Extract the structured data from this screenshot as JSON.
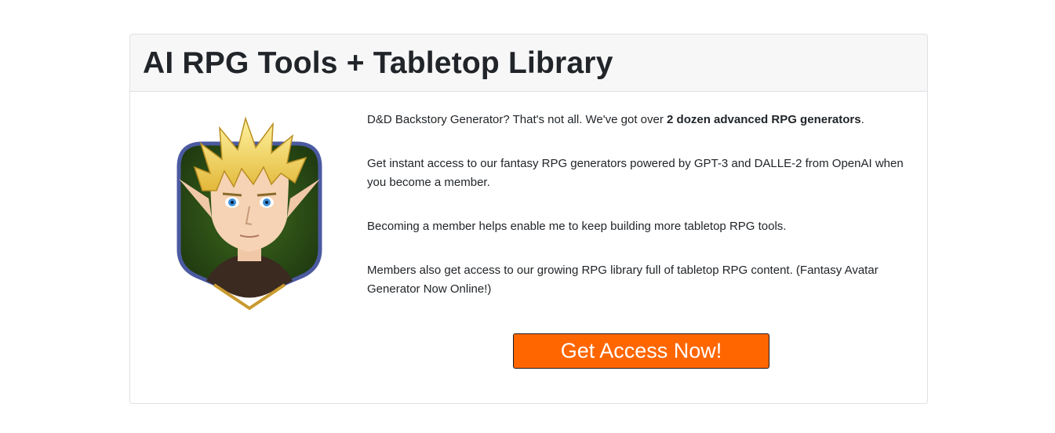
{
  "header": {
    "title": "AI RPG Tools + Tabletop Library"
  },
  "content": {
    "p1_before": "D&D Backstory Generator? That's not all. We've got over ",
    "p1_bold": "2 dozen advanced RPG generators",
    "p1_after": ".",
    "p2": "Get instant access to our fantasy RPG generators powered by GPT-3 and DALLE-2 from OpenAI when you become a member.",
    "p3": "Becoming a member helps enable me to keep building more tabletop RPG tools.",
    "p4": "Members also get access to our growing RPG library full of tabletop RPG content. (Fantasy Avatar Generator Now Online!)"
  },
  "cta": {
    "label": "Get Access Now!"
  },
  "colors": {
    "accent": "#ff6600",
    "header_bg": "#f7f7f8",
    "border": "#dfe1e4"
  },
  "avatar": {
    "icon": "elf-avatar-icon"
  }
}
